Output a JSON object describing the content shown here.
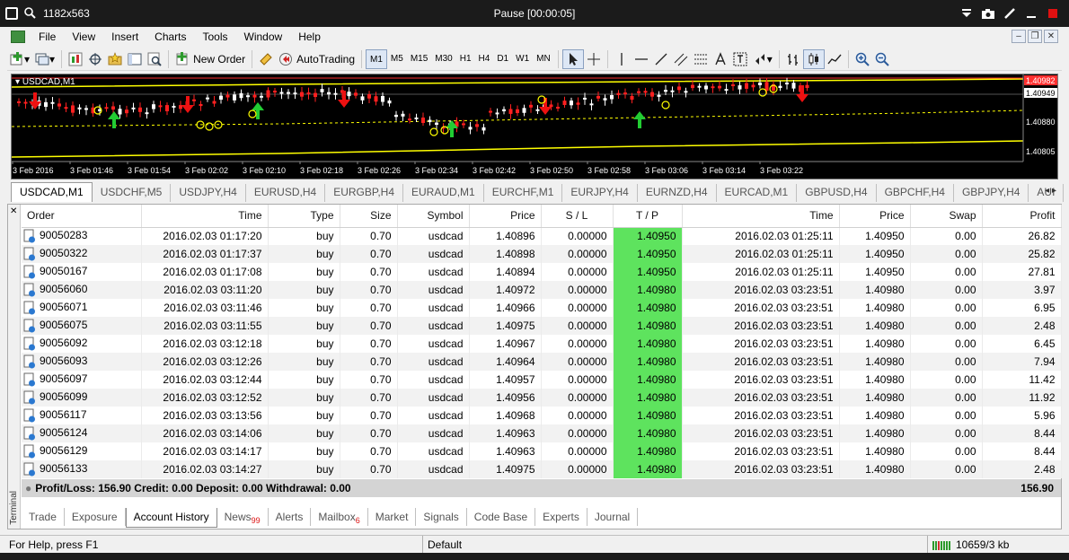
{
  "window": {
    "resolution_label": "1182x563",
    "status_title": "Pause [00:00:05]"
  },
  "menu": [
    "File",
    "View",
    "Insert",
    "Charts",
    "Tools",
    "Window",
    "Help"
  ],
  "toolbar": {
    "new_order": "New Order",
    "auto_trading": "AutoTrading",
    "timeframes": [
      "M1",
      "M5",
      "M15",
      "M30",
      "H1",
      "H4",
      "D1",
      "W1",
      "MN"
    ]
  },
  "chart": {
    "symbol_label": "USDCAD,M1",
    "price_labels": [
      "1.40982",
      "1.40949",
      "1.40880",
      "1.40805"
    ],
    "time_labels": [
      "3 Feb 2016",
      "3 Feb 01:46",
      "3 Feb 01:54",
      "3 Feb 02:02",
      "3 Feb 02:10",
      "3 Feb 02:18",
      "3 Feb 02:26",
      "3 Feb 02:34",
      "3 Feb 02:42",
      "3 Feb 02:50",
      "3 Feb 02:58",
      "3 Feb 03:06",
      "3 Feb 03:14",
      "3 Feb 03:22"
    ]
  },
  "chart_tabs": [
    "USDCAD,M1",
    "USDCHF,M5",
    "USDJPY,H4",
    "EURUSD,H4",
    "EURGBP,H4",
    "EURAUD,M1",
    "EURCHF,M1",
    "EURJPY,H4",
    "EURNZD,H4",
    "EURCAD,M1",
    "GBPUSD,H4",
    "GBPCHF,H4",
    "GBPJPY,H4",
    "AUI"
  ],
  "columns": [
    "Order",
    "Time",
    "Type",
    "Size",
    "Symbol",
    "Price",
    "S / L",
    "T / P",
    "Time",
    "Price",
    "Swap",
    "Profit"
  ],
  "rows": [
    [
      "90050283",
      "2016.02.03 01:17:20",
      "buy",
      "0.70",
      "usdcad",
      "1.40896",
      "0.00000",
      "1.40950",
      "2016.02.03 01:25:11",
      "1.40950",
      "0.00",
      "26.82"
    ],
    [
      "90050322",
      "2016.02.03 01:17:37",
      "buy",
      "0.70",
      "usdcad",
      "1.40898",
      "0.00000",
      "1.40950",
      "2016.02.03 01:25:11",
      "1.40950",
      "0.00",
      "25.82"
    ],
    [
      "90050167",
      "2016.02.03 01:17:08",
      "buy",
      "0.70",
      "usdcad",
      "1.40894",
      "0.00000",
      "1.40950",
      "2016.02.03 01:25:11",
      "1.40950",
      "0.00",
      "27.81"
    ],
    [
      "90056060",
      "2016.02.03 03:11:20",
      "buy",
      "0.70",
      "usdcad",
      "1.40972",
      "0.00000",
      "1.40980",
      "2016.02.03 03:23:51",
      "1.40980",
      "0.00",
      "3.97"
    ],
    [
      "90056071",
      "2016.02.03 03:11:46",
      "buy",
      "0.70",
      "usdcad",
      "1.40966",
      "0.00000",
      "1.40980",
      "2016.02.03 03:23:51",
      "1.40980",
      "0.00",
      "6.95"
    ],
    [
      "90056075",
      "2016.02.03 03:11:55",
      "buy",
      "0.70",
      "usdcad",
      "1.40975",
      "0.00000",
      "1.40980",
      "2016.02.03 03:23:51",
      "1.40980",
      "0.00",
      "2.48"
    ],
    [
      "90056092",
      "2016.02.03 03:12:18",
      "buy",
      "0.70",
      "usdcad",
      "1.40967",
      "0.00000",
      "1.40980",
      "2016.02.03 03:23:51",
      "1.40980",
      "0.00",
      "6.45"
    ],
    [
      "90056093",
      "2016.02.03 03:12:26",
      "buy",
      "0.70",
      "usdcad",
      "1.40964",
      "0.00000",
      "1.40980",
      "2016.02.03 03:23:51",
      "1.40980",
      "0.00",
      "7.94"
    ],
    [
      "90056097",
      "2016.02.03 03:12:44",
      "buy",
      "0.70",
      "usdcad",
      "1.40957",
      "0.00000",
      "1.40980",
      "2016.02.03 03:23:51",
      "1.40980",
      "0.00",
      "11.42"
    ],
    [
      "90056099",
      "2016.02.03 03:12:52",
      "buy",
      "0.70",
      "usdcad",
      "1.40956",
      "0.00000",
      "1.40980",
      "2016.02.03 03:23:51",
      "1.40980",
      "0.00",
      "11.92"
    ],
    [
      "90056117",
      "2016.02.03 03:13:56",
      "buy",
      "0.70",
      "usdcad",
      "1.40968",
      "0.00000",
      "1.40980",
      "2016.02.03 03:23:51",
      "1.40980",
      "0.00",
      "5.96"
    ],
    [
      "90056124",
      "2016.02.03 03:14:06",
      "buy",
      "0.70",
      "usdcad",
      "1.40963",
      "0.00000",
      "1.40980",
      "2016.02.03 03:23:51",
      "1.40980",
      "0.00",
      "8.44"
    ],
    [
      "90056129",
      "2016.02.03 03:14:17",
      "buy",
      "0.70",
      "usdcad",
      "1.40963",
      "0.00000",
      "1.40980",
      "2016.02.03 03:23:51",
      "1.40980",
      "0.00",
      "8.44"
    ],
    [
      "90056133",
      "2016.02.03 03:14:27",
      "buy",
      "0.70",
      "usdcad",
      "1.40975",
      "0.00000",
      "1.40980",
      "2016.02.03 03:23:51",
      "1.40980",
      "0.00",
      "2.48"
    ]
  ],
  "summary": {
    "text": "Profit/Loss: 156.90  Credit: 0.00  Deposit: 0.00  Withdrawal: 0.00",
    "total": "156.90"
  },
  "terminal_label": "Terminal",
  "terminal_tabs": [
    {
      "label": "Trade",
      "badge": ""
    },
    {
      "label": "Exposure",
      "badge": ""
    },
    {
      "label": "Account History",
      "badge": ""
    },
    {
      "label": "News",
      "badge": "99"
    },
    {
      "label": "Alerts",
      "badge": ""
    },
    {
      "label": "Mailbox",
      "badge": "6"
    },
    {
      "label": "Market",
      "badge": ""
    },
    {
      "label": "Signals",
      "badge": ""
    },
    {
      "label": "Code Base",
      "badge": ""
    },
    {
      "label": "Experts",
      "badge": ""
    },
    {
      "label": "Journal",
      "badge": ""
    }
  ],
  "active_terminal_tab": "Account History",
  "status": {
    "help": "For Help, press F1",
    "profile": "Default",
    "traffic": "10659/3 kb"
  },
  "colors": {
    "tp_highlight": "#5ee35e",
    "chart_bg": "#000000",
    "bull_candle": "#ffffff",
    "bear_candle": "#ff0000",
    "buy_arrow": "#22cc33",
    "sell_arrow": "#ee1111"
  }
}
